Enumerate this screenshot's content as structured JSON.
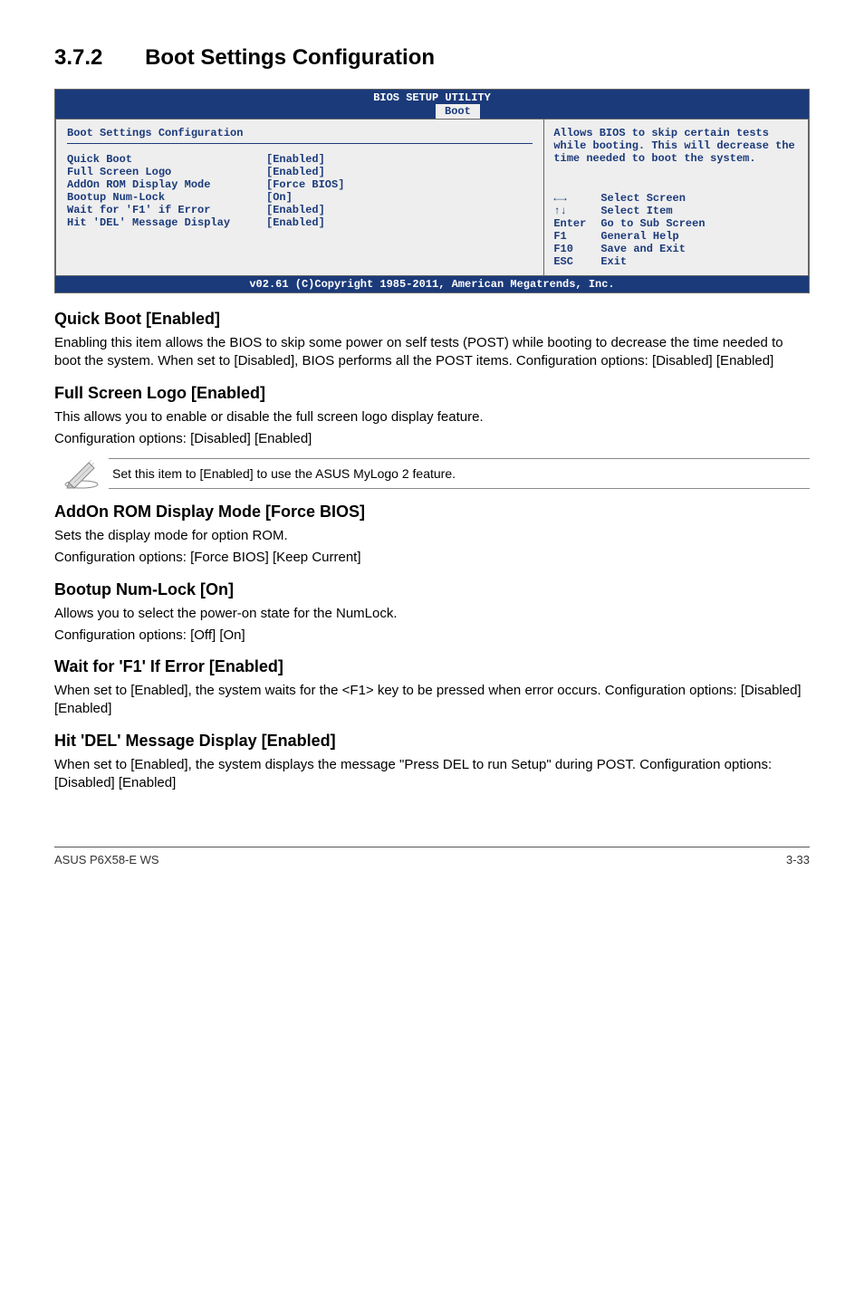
{
  "section": {
    "number": "3.7.2",
    "title": "Boot Settings Configuration"
  },
  "bios": {
    "header": "BIOS SETUP UTILITY",
    "tab": "Boot",
    "left_title": "Boot Settings Configuration",
    "rows": [
      {
        "label": "Quick Boot",
        "value": "[Enabled]"
      },
      {
        "label": "Full Screen Logo",
        "value": "[Enabled]"
      },
      {
        "label": "AddOn ROM Display Mode",
        "value": "[Force BIOS]"
      },
      {
        "label": "Bootup Num-Lock",
        "value": "[On]"
      },
      {
        "label": "Wait for 'F1' if Error",
        "value": "[Enabled]"
      },
      {
        "label": "Hit 'DEL' Message Display",
        "value": "[Enabled]"
      }
    ],
    "help_text": "Allows BIOS to skip certain tests while booting. This will decrease the time needed to boot the system.",
    "nav": [
      {
        "key": "←→",
        "action": "Select Screen"
      },
      {
        "key": "↑↓",
        "action": "Select Item"
      },
      {
        "key": "Enter",
        "action": "Go to Sub Screen"
      },
      {
        "key": "F1",
        "action": "General Help"
      },
      {
        "key": "F10",
        "action": "Save and Exit"
      },
      {
        "key": "ESC",
        "action": "Exit"
      }
    ],
    "footer": "v02.61 (C)Copyright 1985-2011, American Megatrends, Inc."
  },
  "subs": {
    "quick_boot": {
      "heading": "Quick Boot [Enabled]",
      "text": "Enabling this item allows the BIOS to skip some power on self tests (POST) while booting to decrease the time needed to boot the system. When set to [Disabled], BIOS performs all the POST items. Configuration options: [Disabled] [Enabled]"
    },
    "full_screen_logo": {
      "heading": "Full Screen Logo [Enabled]",
      "line1": "This allows you to enable or disable the full screen logo display feature.",
      "line2": "Configuration options: [Disabled] [Enabled]"
    },
    "note_text": "Set this item to [Enabled] to use the ASUS MyLogo 2 feature.",
    "addon_rom": {
      "heading": "AddOn ROM Display Mode [Force BIOS]",
      "line1": "Sets the display mode for option ROM.",
      "line2": "Configuration options: [Force BIOS] [Keep Current]"
    },
    "bootup_numlock": {
      "heading": "Bootup Num-Lock [On]",
      "line1": "Allows you to select the power-on state for the NumLock.",
      "line2": "Configuration options: [Off] [On]"
    },
    "wait_f1": {
      "heading": "Wait for 'F1' If Error [Enabled]",
      "text": "When set to [Enabled], the system waits for the <F1> key to be pressed when error occurs. Configuration options: [Disabled] [Enabled]"
    },
    "hit_del": {
      "heading": "Hit 'DEL' Message Display [Enabled]",
      "text": "When set to [Enabled], the system displays the message \"Press DEL to run Setup\" during POST. Configuration options: [Disabled] [Enabled]"
    }
  },
  "footer": {
    "left": "ASUS P6X58-E WS",
    "right": "3-33"
  }
}
